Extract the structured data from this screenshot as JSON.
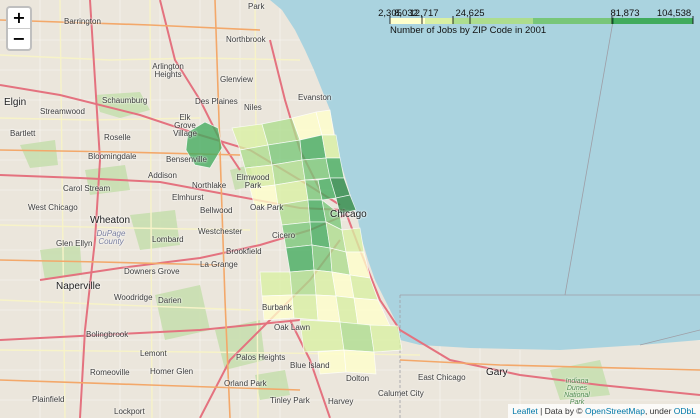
{
  "zoom": {
    "in_label": "+",
    "out_label": "−"
  },
  "legend": {
    "title": "Number of Jobs by ZIP Code in 2001",
    "ticks": [
      "2,305",
      "8,032",
      "12,717",
      "24,625",
      "81,873",
      "104,538"
    ],
    "colors": [
      "#ffffcc",
      "#d9f0a3",
      "#addd8e",
      "#78c679",
      "#41ab5d",
      "#238443"
    ]
  },
  "places": {
    "park": "Park",
    "barrington": "Barrington",
    "northbrook": "Northbrook",
    "arlington_heights": "Arlington Heights",
    "glenview": "Glenview",
    "elgin": "Elgin",
    "streamwood": "Streamwood",
    "schaumburg": "Schaumburg",
    "des_plaines": "Des Plaines",
    "niles": "Niles",
    "evanston": "Evanston",
    "bartlett": "Bartlett",
    "roselle": "Roselle",
    "elk_grove_village": "Elk Grove Village",
    "bloomingdale": "Bloomingdale",
    "bensenville": "Bensenville",
    "elmwood_park": "Elmwood Park",
    "addison": "Addison",
    "northlake": "Northlake",
    "carol_stream": "Carol Stream",
    "elmhurst": "Elmhurst",
    "bellwood": "Bellwood",
    "oak_park": "Oak Park",
    "west_chicago": "West Chicago",
    "wheaton": "Wheaton",
    "westchester": "Westchester",
    "cicero": "Cicero",
    "dupage_county": "DuPage County",
    "chicago": "Chicago",
    "lombard": "Lombard",
    "glen_ellyn": "Glen Ellyn",
    "brookfield": "Brookfield",
    "la_grange": "La Grange",
    "naperville": "Naperville",
    "downers_grove": "Downers Grove",
    "woodridge": "Woodridge",
    "darien": "Darien",
    "bolingbrook": "Bolingbrook",
    "burbank": "Burbank",
    "oak_lawn": "Oak Lawn",
    "lemont": "Lemont",
    "palos_heights": "Palos Heights",
    "blue_island": "Blue Island",
    "romeoville": "Romeoville",
    "homer_glen": "Homer Glen",
    "orland_park": "Orland Park",
    "tinley_park": "Tinley Park",
    "dolton": "Dolton",
    "calumet_city": "Calumet City",
    "east_chicago": "East Chicago",
    "gary": "Gary",
    "plainfield": "Plainfield",
    "lockport": "Lockport",
    "harvey": "Harvey",
    "indiana_dunes": "Indiana Dunes National Park"
  },
  "attribution": {
    "leaflet": "Leaflet",
    "data_by": " | Data by © ",
    "osm": "OpenStreetMap",
    "under": ", under ",
    "odbl": "ODbL"
  }
}
